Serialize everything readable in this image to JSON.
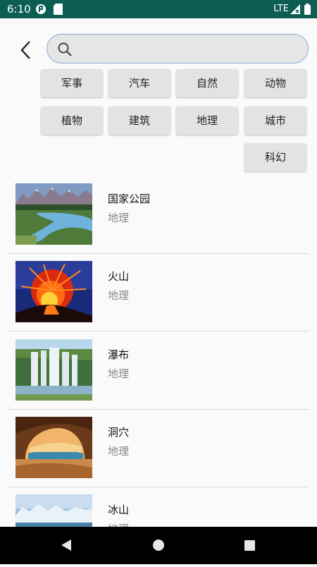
{
  "status": {
    "time": "6:10",
    "network": "LTE"
  },
  "search": {
    "placeholder": ""
  },
  "categories": [
    "军事",
    "汽车",
    "自然",
    "动物",
    "植物",
    "建筑",
    "地理",
    "城市",
    "科幻"
  ],
  "items": [
    {
      "title": "国家公园",
      "subtitle": "地理",
      "image": "national-park-photo"
    },
    {
      "title": "火山",
      "subtitle": "地理",
      "image": "volcano-photo"
    },
    {
      "title": "瀑布",
      "subtitle": "地理",
      "image": "waterfall-photo"
    },
    {
      "title": "洞穴",
      "subtitle": "地理",
      "image": "cave-photo"
    },
    {
      "title": "冰山",
      "subtitle": "地理",
      "image": "iceberg-photo"
    }
  ],
  "colors": {
    "statusbar": "#0d5e52",
    "chip": "#e3e3e3",
    "search_border": "#8ea6d6"
  }
}
